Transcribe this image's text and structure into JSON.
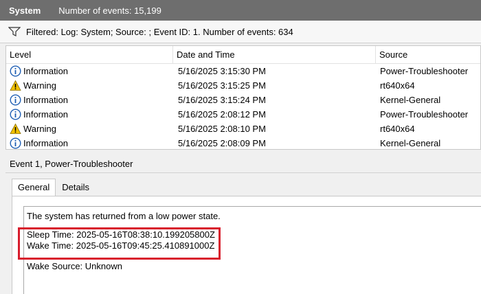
{
  "titlebar": {
    "log_name": "System",
    "event_count": "Number of events: 15,199"
  },
  "filter": {
    "icon": "funnel-icon",
    "text": "Filtered: Log: System; Source: ; Event ID: 1. Number of events: 634"
  },
  "grid": {
    "columns": [
      "Level",
      "Date and Time",
      "Source"
    ],
    "rows": [
      {
        "level": "Information",
        "icon": "info-icon",
        "date": "5/16/2025 3:15:30 PM",
        "source": "Power-Troubleshooter"
      },
      {
        "level": "Warning",
        "icon": "warning-icon",
        "date": "5/16/2025 3:15:25 PM",
        "source": "rt640x64"
      },
      {
        "level": "Information",
        "icon": "info-icon",
        "date": "5/16/2025 3:15:24 PM",
        "source": "Kernel-General"
      },
      {
        "level": "Information",
        "icon": "info-icon",
        "date": "5/16/2025 2:08:12 PM",
        "source": "Power-Troubleshooter"
      },
      {
        "level": "Warning",
        "icon": "warning-icon",
        "date": "5/16/2025 2:08:10 PM",
        "source": "rt640x64"
      },
      {
        "level": "Information",
        "icon": "info-icon",
        "date": "5/16/2025 2:08:09 PM",
        "source": "Kernel-General"
      }
    ]
  },
  "details": {
    "title": "Event 1, Power-Troubleshooter",
    "tabs": [
      "General",
      "Details"
    ],
    "active_tab": "General",
    "lines": {
      "intro": "The system has returned from a low power state.",
      "sleep_time": "Sleep Time: 2025-05-16T08:38:10.199205800Z",
      "wake_time": "Wake Time: 2025-05-16T09:45:25.410891000Z",
      "wake_source": "Wake Source: Unknown"
    }
  },
  "colors": {
    "titlebar": "#6e6e6e",
    "highlight": "#d81c2c",
    "info_icon": "#1f5fb4",
    "warning_icon": "#f2c200"
  }
}
